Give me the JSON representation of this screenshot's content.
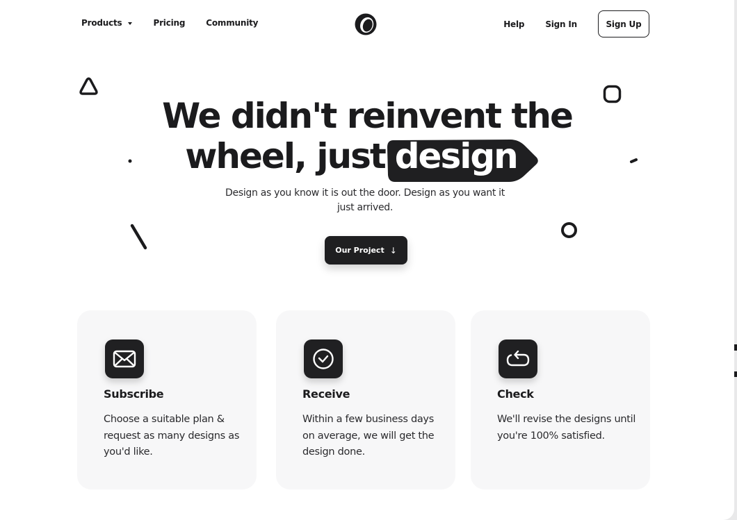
{
  "nav": {
    "products": "Products",
    "pricing": "Pricing",
    "community": "Community",
    "help": "Help",
    "sign_in": "Sign In",
    "sign_up": "Sign Up"
  },
  "hero": {
    "line1": "We didn't reinvent the",
    "line2": "wheel, just",
    "highlight": "design",
    "subtitle": "Design as you know it is out the door. Design as you want it just arrived.",
    "cta": "Our Project",
    "cta_arrow": "↓"
  },
  "features": [
    {
      "title": "Subscribe",
      "text": "Choose a suitable plan & request as many designs as you'd like.",
      "icon": "envelope-icon"
    },
    {
      "title": "Receive",
      "text": "Within a few business days on average, we will get the design done.",
      "icon": "clock-check-icon"
    },
    {
      "title": "Check",
      "text": "We'll revise the designs until you're 100% satisfied.",
      "icon": "revise-loop-icon"
    }
  ],
  "colors": {
    "ink": "#1b1b1d",
    "card_bg": "#f7f7f8",
    "page_bg": "#ffffff"
  }
}
